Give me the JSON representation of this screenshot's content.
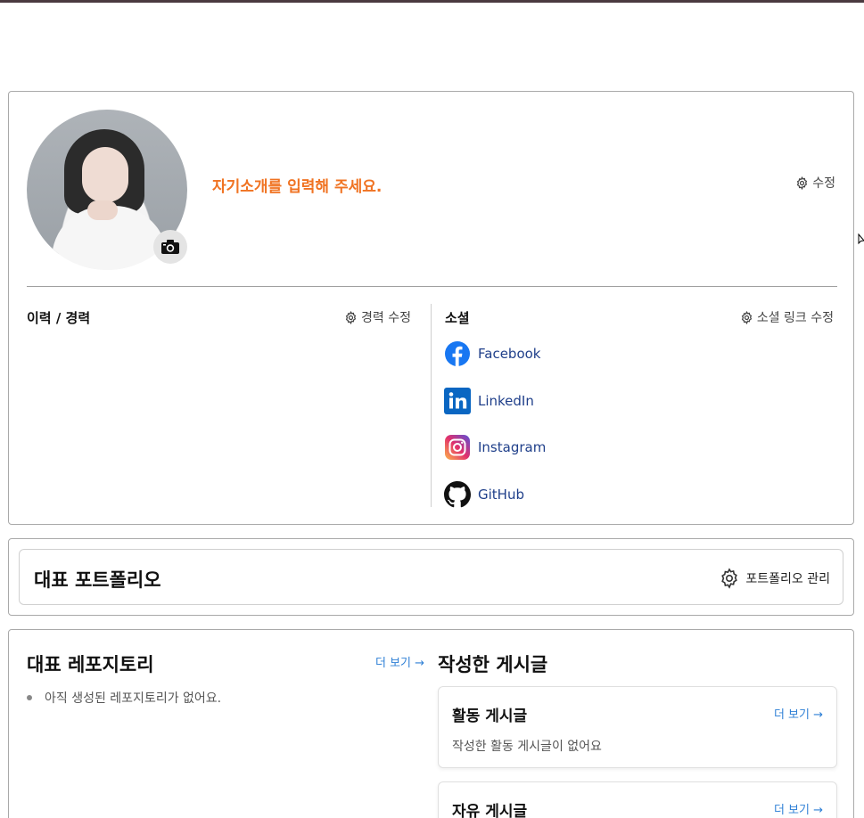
{
  "profile": {
    "intro_placeholder": "자기소개를 입력해 주세요.",
    "intro_edit_label": "수정",
    "camera_icon": "camera-icon",
    "career": {
      "title": "이력 / 경력",
      "edit_label": "경력 수정"
    },
    "social": {
      "title": "소셜",
      "edit_label": "소셜 링크 수정",
      "links": [
        {
          "label": "Facebook",
          "icon": "facebook-icon",
          "color": "#1877f2"
        },
        {
          "label": "LinkedIn",
          "icon": "linkedin-icon",
          "color": "#0a66c2"
        },
        {
          "label": "Instagram",
          "icon": "instagram-icon",
          "color": "#d6249f"
        },
        {
          "label": "GitHub",
          "icon": "github-icon",
          "color": "#111111"
        }
      ]
    }
  },
  "portfolio": {
    "title": "대표 포트폴리오",
    "manage_label": "포트폴리오 관리"
  },
  "repositories": {
    "title": "대표 레포지토리",
    "more_label": "더 보기 →",
    "empty_text": "아직 생성된 레포지토리가 없어요."
  },
  "posts": {
    "title": "작성한 게시글",
    "activity": {
      "title": "활동 게시글",
      "more_label": "더 보기 →",
      "empty_text": "작성한 활동 게시글이 없어요"
    },
    "free": {
      "title": "자유 게시글",
      "more_label": "더 보기 →"
    }
  },
  "colors": {
    "accent": "#f07322",
    "link": "#2f80d6",
    "social_text": "#1f3f8a"
  }
}
